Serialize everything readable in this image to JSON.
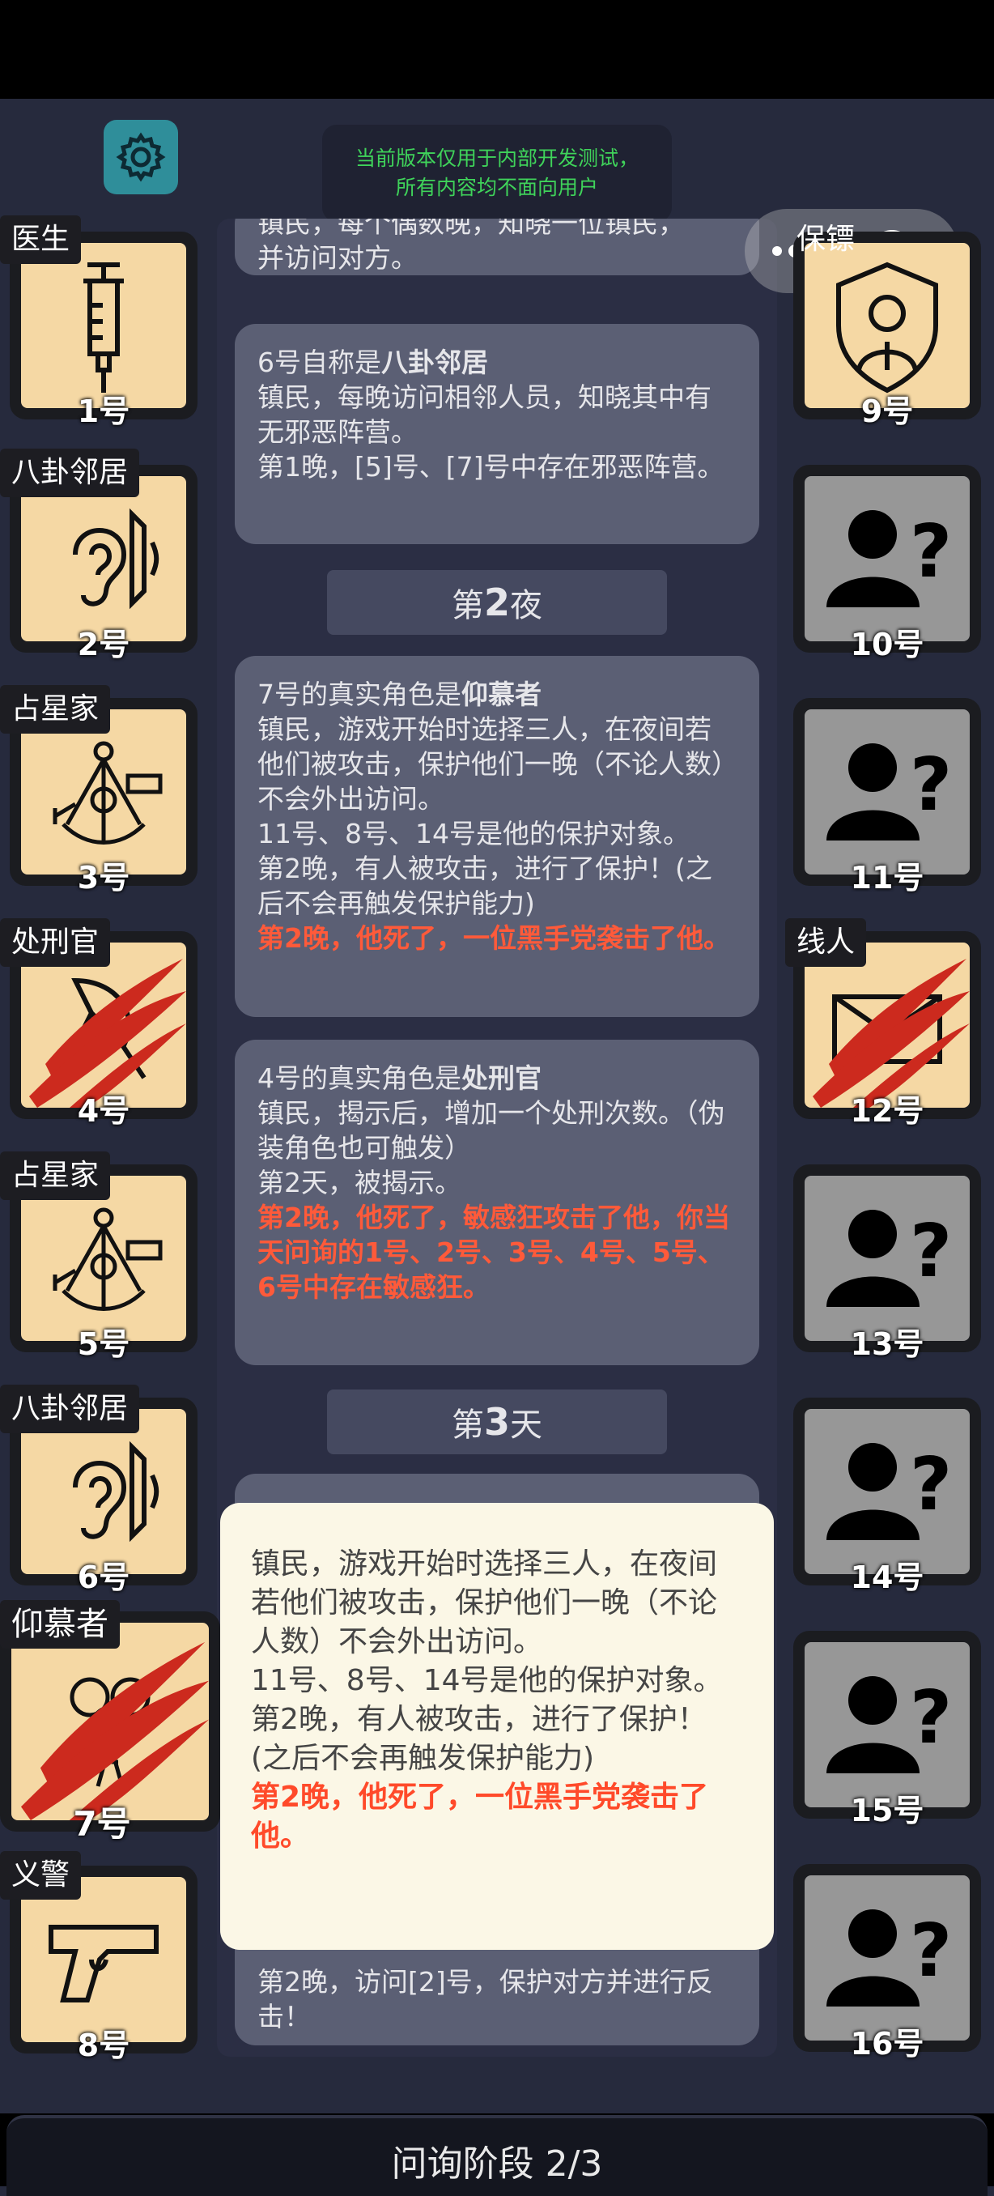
{
  "notice": {
    "line1": "当前版本仅用于内部开发测试，",
    "line2": "所有内容均不面向用户"
  },
  "log": {
    "card0": {
      "tail": "镇民，每个偶数晚，知晓一位镇民，",
      "tail2": "并访问对方。"
    },
    "card1": {
      "prefix": "6号自称是",
      "role": "八卦邻居",
      "desc": "镇民，每晚访问相邻人员，知晓其中有无邪恶阵营。",
      "result": "第1晚，[5]号、[7]号中存在邪恶阵营。"
    },
    "divider_night2": {
      "pre": "第",
      "num": "2",
      "post": "夜"
    },
    "card2": {
      "prefix": "7号的真实角色是",
      "role": "仰慕者",
      "desc": "镇民，游戏开始时选择三人，在夜间若他们被攻击，保护他们一晚（不论人数）不会外出访问。",
      "line2": "11号、8号、14号是他的保护对象。",
      "line3": "第2晚，有人被攻击，进行了保护！(之后不会再触发保护能力)",
      "death": "第2晚，他死了，一位黑手党袭击了他。"
    },
    "card3": {
      "prefix": "4号的真实角色是",
      "role": "处刑官",
      "desc": "镇民，揭示后，增加一个处刑次数。（伪装角色也可触发）",
      "line2": "第2天，被揭示。",
      "death": "第2晚，他死了，敏感狂攻击了他，你当天问询的1号、2号、3号、4号、5号、6号中存在敏感狂。"
    },
    "divider_day3": {
      "pre": "第",
      "num": "3",
      "post": "天"
    },
    "card4": {
      "tail": "第2晚，访问[2]号，保护对方并进行反击！"
    }
  },
  "popup": {
    "desc": "镇民，游戏开始时选择三人，在夜间若他们被攻击，保护他们一晚（不论人数）不会外出访问。",
    "line2": "11号、8号、14号是他的保护对象。",
    "line3": "第2晚，有人被攻击，进行了保护！(之后不会再触发保护能力)",
    "death": "第2晚，他死了，一位黑手党袭击了他。"
  },
  "players_left": [
    {
      "role": "医生",
      "num": "1号",
      "icon": "syringe-icon",
      "dead": false
    },
    {
      "role": "八卦邻居",
      "num": "2号",
      "icon": "ear-icon",
      "dead": false
    },
    {
      "role": "占星家",
      "num": "3号",
      "icon": "sextant-icon",
      "dead": false
    },
    {
      "role": "处刑官",
      "num": "4号",
      "icon": "axe-icon",
      "dead": true
    },
    {
      "role": "占星家",
      "num": "5号",
      "icon": "sextant-icon",
      "dead": false
    },
    {
      "role": "八卦邻居",
      "num": "6号",
      "icon": "ear-icon",
      "dead": false
    },
    {
      "role": "仰慕者",
      "num": "7号",
      "icon": "bouquet-icon",
      "dead": true
    },
    {
      "role": "义警",
      "num": "8号",
      "icon": "pistol-icon",
      "dead": false
    }
  ],
  "players_right": [
    {
      "role": "保镖",
      "num": "9号",
      "icon": "bodyguard-shield-icon",
      "dead": false
    },
    {
      "role": "",
      "num": "10号",
      "icon": "unknown-person-icon",
      "dead": false
    },
    {
      "role": "",
      "num": "11号",
      "icon": "unknown-person-icon",
      "dead": false
    },
    {
      "role": "线人",
      "num": "12号",
      "icon": "envelope-icon",
      "dead": true
    },
    {
      "role": "",
      "num": "13号",
      "icon": "unknown-person-icon",
      "dead": false
    },
    {
      "role": "",
      "num": "14号",
      "icon": "unknown-person-icon",
      "dead": false
    },
    {
      "role": "",
      "num": "15号",
      "icon": "unknown-person-icon",
      "dead": false
    },
    {
      "role": "",
      "num": "16号",
      "icon": "unknown-person-icon",
      "dead": false
    }
  ],
  "phase": {
    "label": "问询阶段 2/3"
  },
  "colors": {
    "background": "#262a3d",
    "card": "#5b5f74",
    "death_text": "#ff5a3a",
    "notice_text": "#3fd35a",
    "alive_tile": "#f5d8a4",
    "unknown_tile": "#979797"
  }
}
